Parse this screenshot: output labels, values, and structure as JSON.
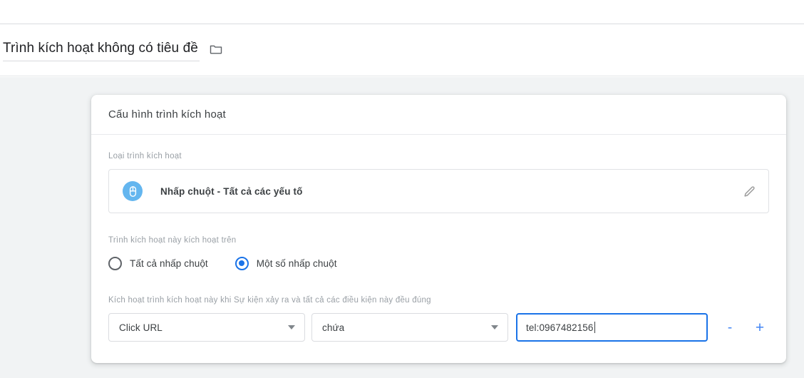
{
  "theme": {
    "accent_blue": "#1a73e8",
    "link_blue": "#4285f4",
    "mouse_badge_blue": "#64b6ef",
    "page_bg": "#f1f3f4",
    "card_bg": "#ffffff",
    "text_primary": "#3c4043",
    "text_muted": "#9aa0a6"
  },
  "header": {
    "trigger_title": "Trình kích hoạt không có tiêu đề",
    "folder_icon": "folder-icon"
  },
  "card": {
    "title": "Cấu hình trình kích hoạt",
    "trigger_type": {
      "label": "Loại trình kích hoạt",
      "icon": "mouse-click-icon",
      "name": "Nhấp chuột - Tất cả các yếu tố",
      "edit_icon": "pencil-icon"
    },
    "fires_on": {
      "label": "Trình kích hoạt này kích hoạt trên",
      "options": [
        {
          "label": "Tất cả nhấp chuột",
          "selected": false
        },
        {
          "label": "Một số nhấp chuột",
          "selected": true
        }
      ]
    },
    "conditions": {
      "label": "Kích hoạt trình kích hoạt này khi Sự kiện xảy ra và tất cả các điều kiện này đều đúng",
      "row": {
        "variable": "Click URL",
        "operator": "chứa",
        "value": "tel:0967482156",
        "remove_label": "-",
        "add_label": "+"
      }
    }
  }
}
